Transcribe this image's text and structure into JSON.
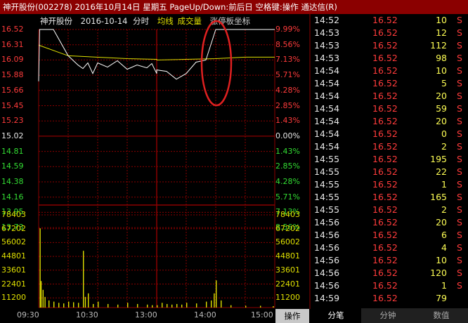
{
  "window": {
    "title": "神开股份(002278)  2016年10月14日  星期五  PageUp/Down:前后日  空格键:操作  通达信(R)"
  },
  "chart_info": {
    "stock_name": "神开股份",
    "date_label": "2016-10-14",
    "mode": "分时",
    "avg_label": "均线",
    "vol_label": "成交量",
    "limit_label": "涨停板坐标"
  },
  "colors": {
    "up": "#ff3b3b",
    "down": "#33dd33",
    "neutral": "#e8e8e8",
    "volume": "#e0e000",
    "grid": "#8b0000",
    "price_line": "#ffffff",
    "avg_line": "#e0e000",
    "annotation": "#e02020"
  },
  "price_axis": {
    "left_labels": [
      "16.52",
      "16.31",
      "16.09",
      "15.88",
      "15.66",
      "15.45",
      "15.23",
      "15.02",
      "14.81",
      "14.59",
      "14.38",
      "14.16",
      "13.95",
      "13.73"
    ],
    "right_labels": [
      "9.99%",
      "8.56%",
      "7.13%",
      "5.71%",
      "4.28%",
      "2.85%",
      "1.43%",
      "0.00%",
      "1.43%",
      "2.85%",
      "4.28%",
      "5.71%",
      "7.13%",
      "8.56%"
    ]
  },
  "volume_axis": {
    "labels": [
      "78403",
      "67202",
      "56002",
      "44801",
      "33601",
      "22401",
      "11200"
    ]
  },
  "time_axis": {
    "ticks": [
      "09:30",
      "10:30",
      "13:00",
      "14:00",
      "15:00"
    ]
  },
  "operate_button": {
    "label": "操作"
  },
  "tabs": [
    "分笔",
    "分钟",
    "数值"
  ],
  "trades": [
    {
      "time": "14:52",
      "price": "16.52",
      "vol": "10",
      "side": "S"
    },
    {
      "time": "14:53",
      "price": "16.52",
      "vol": "12",
      "side": "S"
    },
    {
      "time": "14:53",
      "price": "16.52",
      "vol": "112",
      "side": "S"
    },
    {
      "time": "14:53",
      "price": "16.52",
      "vol": "98",
      "side": "S"
    },
    {
      "time": "14:54",
      "price": "16.52",
      "vol": "10",
      "side": "S"
    },
    {
      "time": "14:54",
      "price": "16.52",
      "vol": "5",
      "side": "S"
    },
    {
      "time": "14:54",
      "price": "16.52",
      "vol": "20",
      "side": "S"
    },
    {
      "time": "14:54",
      "price": "16.52",
      "vol": "59",
      "side": "S"
    },
    {
      "time": "14:54",
      "price": "16.52",
      "vol": "20",
      "side": "S"
    },
    {
      "time": "14:54",
      "price": "16.52",
      "vol": "0",
      "side": "S"
    },
    {
      "time": "14:54",
      "price": "16.52",
      "vol": "2",
      "side": "S"
    },
    {
      "time": "14:55",
      "price": "16.52",
      "vol": "195",
      "side": "S"
    },
    {
      "time": "14:55",
      "price": "16.52",
      "vol": "22",
      "side": "S"
    },
    {
      "time": "14:55",
      "price": "16.52",
      "vol": "1",
      "side": "S"
    },
    {
      "time": "14:55",
      "price": "16.52",
      "vol": "165",
      "side": "S"
    },
    {
      "time": "14:55",
      "price": "16.52",
      "vol": "2",
      "side": "S"
    },
    {
      "time": "14:56",
      "price": "16.52",
      "vol": "20",
      "side": "S"
    },
    {
      "time": "14:56",
      "price": "16.52",
      "vol": "6",
      "side": "S"
    },
    {
      "time": "14:56",
      "price": "16.52",
      "vol": "4",
      "side": "S"
    },
    {
      "time": "14:56",
      "price": "16.52",
      "vol": "10",
      "side": "S"
    },
    {
      "time": "14:56",
      "price": "16.52",
      "vol": "120",
      "side": "S"
    },
    {
      "time": "14:56",
      "price": "16.52",
      "vol": "1",
      "side": "S"
    },
    {
      "time": "14:59",
      "price": "16.52",
      "vol": "79",
      "side": ""
    }
  ],
  "chart_data": {
    "type": "line",
    "x_range": [
      "09:30",
      "15:00"
    ],
    "price_series": {
      "name": "price",
      "x": [
        "09:30",
        "09:31",
        "09:45",
        "10:00",
        "10:10",
        "10:15",
        "10:20",
        "10:25",
        "10:30",
        "10:40",
        "10:50",
        "11:00",
        "11:10",
        "11:20",
        "11:25",
        "11:30",
        "13:00",
        "13:10",
        "13:20",
        "13:30",
        "13:40",
        "13:50",
        "14:00",
        "15:00"
      ],
      "y": [
        15.79,
        16.52,
        16.52,
        16.15,
        16.02,
        15.97,
        16.05,
        15.9,
        16.05,
        15.99,
        16.08,
        15.96,
        16.02,
        15.98,
        16.04,
        15.9,
        15.95,
        15.93,
        15.82,
        15.9,
        16.06,
        16.09,
        16.52,
        16.52
      ]
    },
    "avg_series": {
      "name": "均线",
      "x": [
        "09:30",
        "10:00",
        "11:00",
        "11:30",
        "13:00",
        "14:00",
        "14:30",
        "15:00"
      ],
      "y": [
        16.3,
        16.15,
        16.11,
        16.1,
        16.09,
        16.11,
        16.13,
        16.13
      ]
    },
    "volume_bars": [
      {
        "x": "09:31",
        "v": 67000
      },
      {
        "x": "09:32",
        "v": 22400
      },
      {
        "x": "09:34",
        "v": 15000
      },
      {
        "x": "09:36",
        "v": 9000
      },
      {
        "x": "09:40",
        "v": 6000
      },
      {
        "x": "09:45",
        "v": 5000
      },
      {
        "x": "09:50",
        "v": 4000
      },
      {
        "x": "09:55",
        "v": 3500
      },
      {
        "x": "10:00",
        "v": 5000
      },
      {
        "x": "10:05",
        "v": 4500
      },
      {
        "x": "10:10",
        "v": 4000
      },
      {
        "x": "10:15",
        "v": 48000
      },
      {
        "x": "10:17",
        "v": 9000
      },
      {
        "x": "10:20",
        "v": 12000
      },
      {
        "x": "10:25",
        "v": 3000
      },
      {
        "x": "10:30",
        "v": 5000
      },
      {
        "x": "10:40",
        "v": 3000
      },
      {
        "x": "10:50",
        "v": 2500
      },
      {
        "x": "11:00",
        "v": 4000
      },
      {
        "x": "11:10",
        "v": 3000
      },
      {
        "x": "11:20",
        "v": 2500
      },
      {
        "x": "11:25",
        "v": 2000
      },
      {
        "x": "13:00",
        "v": 2000
      },
      {
        "x": "13:05",
        "v": 4000
      },
      {
        "x": "13:10",
        "v": 3000
      },
      {
        "x": "13:15",
        "v": 2500
      },
      {
        "x": "13:20",
        "v": 3000
      },
      {
        "x": "13:25",
        "v": 2500
      },
      {
        "x": "13:30",
        "v": 4000
      },
      {
        "x": "13:40",
        "v": 3500
      },
      {
        "x": "13:50",
        "v": 5000
      },
      {
        "x": "13:55",
        "v": 6000
      },
      {
        "x": "13:58",
        "v": 12000
      },
      {
        "x": "14:00",
        "v": 23000
      },
      {
        "x": "14:05",
        "v": 6000
      },
      {
        "x": "14:15",
        "v": 2000
      },
      {
        "x": "14:30",
        "v": 1500
      },
      {
        "x": "14:45",
        "v": 1500
      },
      {
        "x": "14:58",
        "v": 1200
      }
    ],
    "price_ylim": [
      13.52,
      16.52
    ],
    "volume_ylim": [
      0,
      78403
    ],
    "grid": true,
    "annotation": "red ellipse around 14:00 jump to limit-up"
  }
}
